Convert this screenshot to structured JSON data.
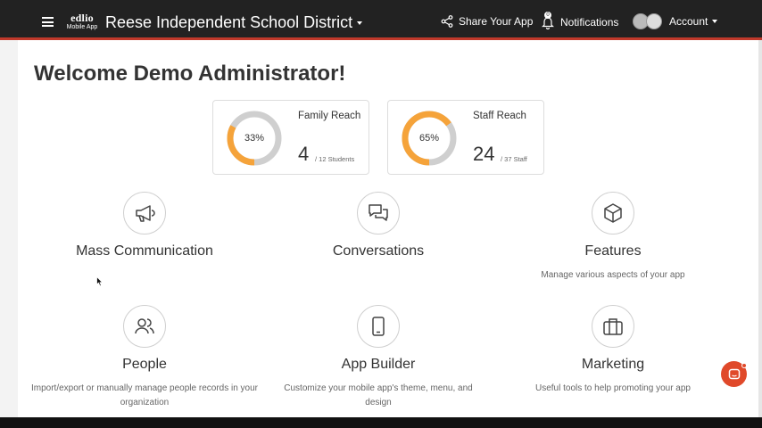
{
  "header": {
    "brand_name": "edlio",
    "brand_sub": "Mobile App",
    "district": "Reese Independent School District",
    "share_label": "Share Your App",
    "notifications_label": "Notifications",
    "notifications_badge": "0",
    "account_label": "Account",
    "accent_color": "#c0392b"
  },
  "welcome": "Welcome Demo Administrator!",
  "stats": [
    {
      "title": "Family Reach",
      "percent_label": "33%",
      "percent": 0.33,
      "count": "4",
      "total": "/ 12 Students"
    },
    {
      "title": "Staff Reach",
      "percent_label": "65%",
      "percent": 0.65,
      "count": "24",
      "total": "/ 37 Staff"
    }
  ],
  "donut_colors": {
    "fill": "#f5a33a",
    "track": "#cfcfcf"
  },
  "tiles": [
    {
      "icon": "megaphone-icon",
      "name": "Mass Communication",
      "desc": ""
    },
    {
      "icon": "chat-bubbles-icon",
      "name": "Conversations",
      "desc": ""
    },
    {
      "icon": "cube-icon",
      "name": "Features",
      "desc": "Manage various aspects of your app"
    },
    {
      "icon": "people-icon",
      "name": "People",
      "desc": "Import/export or manually manage people records in your organization"
    },
    {
      "icon": "phone-icon",
      "name": "App Builder",
      "desc": "Customize your mobile app's theme, menu, and design"
    },
    {
      "icon": "briefcase-icon",
      "name": "Marketing",
      "desc": "Useful tools to help promoting your app"
    }
  ]
}
